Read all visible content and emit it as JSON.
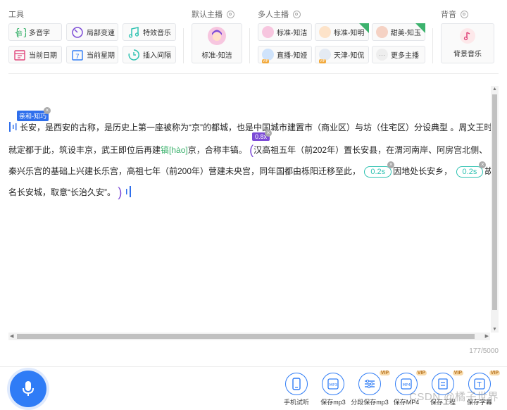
{
  "sections": {
    "tools": "工具",
    "default_anchor": "默认主播",
    "multi_anchor": "多人主播",
    "bgm": "背音"
  },
  "tools": [
    {
      "label": "多音字",
      "icon": "polyphone-icon"
    },
    {
      "label": "局部变速",
      "icon": "speed-icon"
    },
    {
      "label": "特效音乐",
      "icon": "music-icon"
    },
    {
      "label": "当前日期",
      "icon": "date-icon"
    },
    {
      "label": "当前星期",
      "icon": "week-icon"
    },
    {
      "label": "插入间隔",
      "icon": "interval-icon"
    }
  ],
  "default_anchor": {
    "label": "标准-知洁"
  },
  "speakers": [
    {
      "label": "标准-知洁",
      "vip": false,
      "is_new": false
    },
    {
      "label": "标准-知明",
      "vip": false,
      "is_new": true
    },
    {
      "label": "甜美-知玉",
      "vip": false,
      "is_new": true
    },
    {
      "label": "直播-知娅",
      "vip": true,
      "is_new": false
    },
    {
      "label": "天津-知侃",
      "vip": true,
      "is_new": false
    },
    {
      "label": "更多主播",
      "vip": false,
      "is_new": false
    }
  ],
  "vip_label": "VIP",
  "bgm": {
    "label": "背景音乐"
  },
  "editor": {
    "voice_tag": "亲和-知巧",
    "speed_tag": "0.8x",
    "line1": "长安，是西安的古称，是历史上第一座被称为“京”的都城，也是中国城市建置市（商业区）与坊（住宅区）分设典型 。周文王时",
    "line2_a": "就定都于此，筑设丰京，武王即位后再建",
    "line2_hl": "镐[hào]",
    "line2_b": "京，合称丰镐。",
    "line2_c": "汉高祖五年（前202年）置长安县，在渭河南岸、阿房宫北侧、",
    "line3_a": "秦兴乐宫的基础上兴建长乐宫，高祖七年（前200年）营建未央宫，同年国都由栎阳迁移至此，",
    "pause1": "0.2s",
    "line3_b": "因地处长安乡，",
    "pause2": "0.2s",
    "line3_c": "故",
    "line4": "名长安城，取意“长治久安”。"
  },
  "counter": "177/5000",
  "actions": [
    {
      "label": "手机试听",
      "vip": false,
      "icon": "phone-icon"
    },
    {
      "label": "保存mp3",
      "vip": false,
      "icon": "mp3-icon"
    },
    {
      "label": "分段保存mp3",
      "vip": true,
      "icon": "split-icon"
    },
    {
      "label": "保存MP4",
      "vip": true,
      "icon": "mp4-icon"
    },
    {
      "label": "保存工程",
      "vip": true,
      "icon": "project-icon"
    },
    {
      "label": "保存字幕",
      "vip": true,
      "icon": "subtitle-icon"
    }
  ],
  "watermark": "CSDN @橘子世界",
  "colors": {
    "accent": "#2f7cf6",
    "green": "#3cb26d",
    "purple": "#7c4bd6",
    "teal": "#2ec2b1",
    "vip": "#f2a93b"
  }
}
